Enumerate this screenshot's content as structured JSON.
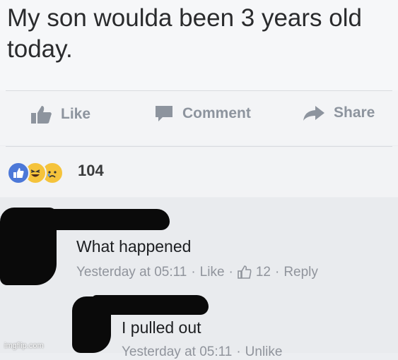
{
  "post": {
    "text": "My son woulda been 3 years old today."
  },
  "actions": {
    "like": "Like",
    "comment": "Comment",
    "share": "Share"
  },
  "reactions": {
    "count": "104",
    "types": [
      "like-icon",
      "haha-icon",
      "sad-icon"
    ]
  },
  "comments": [
    {
      "text": "What happened",
      "time": "Yesterday at 05:11",
      "like": "Like",
      "likes": "12",
      "reply": "Reply"
    },
    {
      "text": "I pulled out",
      "time": "Yesterday at 05:11",
      "action": "Unlike"
    }
  ],
  "watermark": "imgflip.com",
  "colors": {
    "meta": "#90949c",
    "like_blue": "#4267b2"
  }
}
